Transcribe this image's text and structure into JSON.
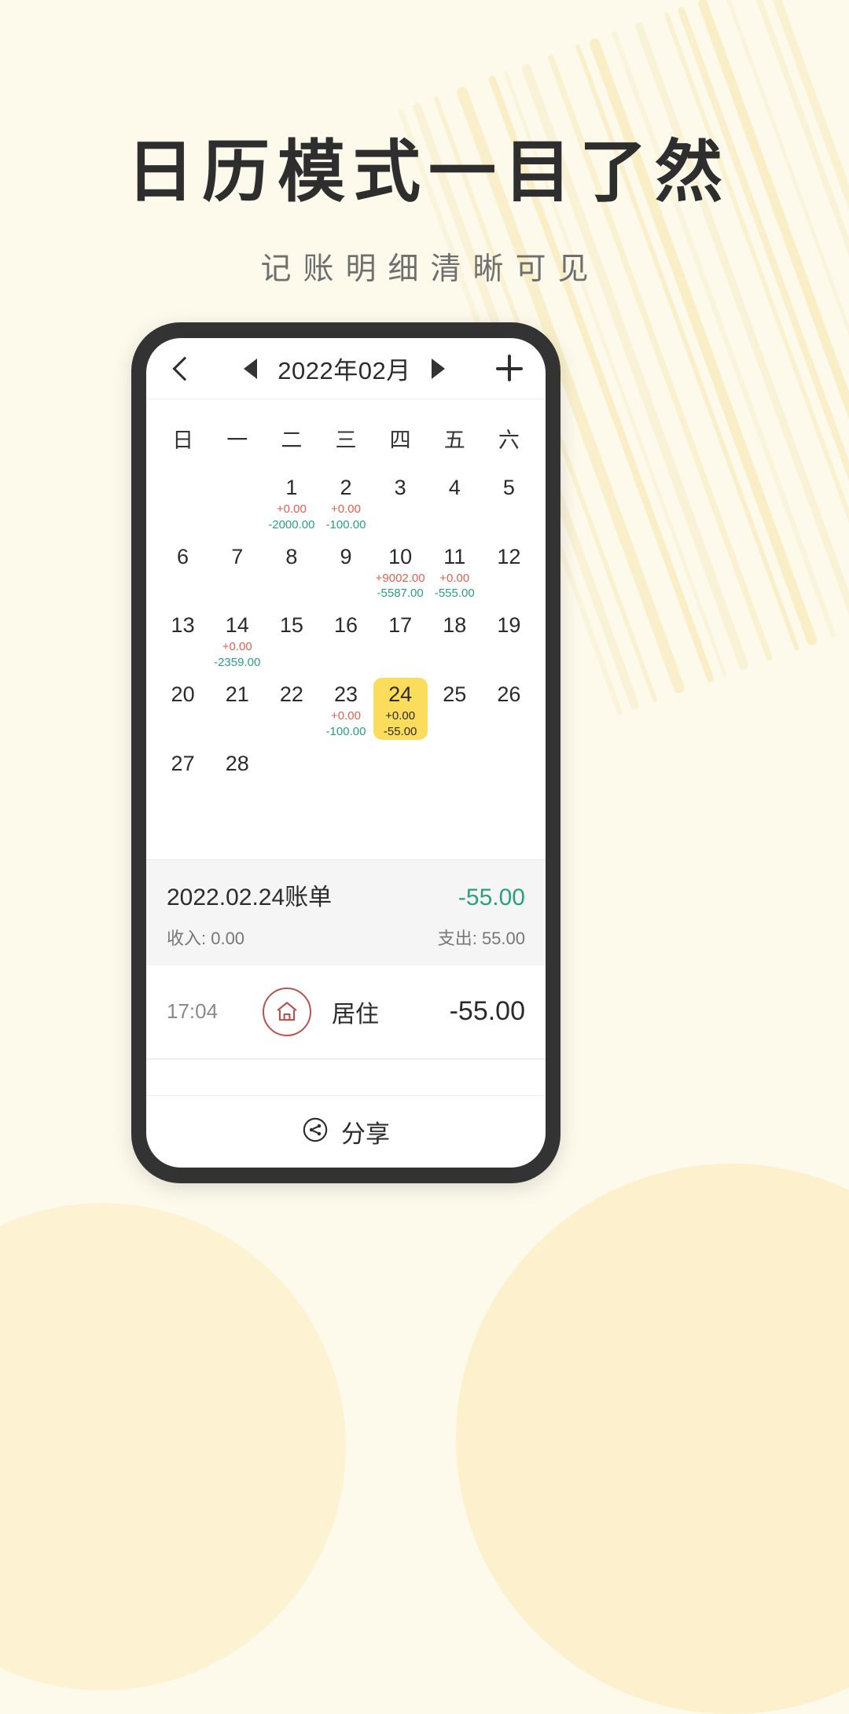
{
  "promo": {
    "headline": "日历模式一目了然",
    "subheadline": "记账明细清晰可见"
  },
  "app": {
    "header": {
      "back_icon": "back-chevron-icon",
      "prev_month_icon": "triangle-left-icon",
      "month_label": "2022年02月",
      "next_month_icon": "triangle-right-icon",
      "add_icon": "plus-icon"
    },
    "calendar": {
      "weekdays": [
        "日",
        "一",
        "二",
        "三",
        "四",
        "五",
        "六"
      ],
      "weeks": [
        [
          {
            "day": ""
          },
          {
            "day": ""
          },
          {
            "day": "1",
            "income": "+0.00",
            "expense": "-2000.00"
          },
          {
            "day": "2",
            "income": "+0.00",
            "expense": "-100.00"
          },
          {
            "day": "3"
          },
          {
            "day": "4"
          },
          {
            "day": "5"
          }
        ],
        [
          {
            "day": "6"
          },
          {
            "day": "7"
          },
          {
            "day": "8"
          },
          {
            "day": "9"
          },
          {
            "day": "10",
            "income": "+9002.00",
            "expense": "-5587.00"
          },
          {
            "day": "11",
            "income": "+0.00",
            "expense": "-555.00"
          },
          {
            "day": "12"
          }
        ],
        [
          {
            "day": "13"
          },
          {
            "day": "14",
            "income": "+0.00",
            "expense": "-2359.00"
          },
          {
            "day": "15"
          },
          {
            "day": "16"
          },
          {
            "day": "17"
          },
          {
            "day": "18"
          },
          {
            "day": "19"
          }
        ],
        [
          {
            "day": "20"
          },
          {
            "day": "21"
          },
          {
            "day": "22"
          },
          {
            "day": "23",
            "income": "+0.00",
            "expense": "-100.00"
          },
          {
            "day": "24",
            "income": "+0.00",
            "expense": "-55.00",
            "selected": true
          },
          {
            "day": "25"
          },
          {
            "day": "26"
          }
        ],
        [
          {
            "day": "27"
          },
          {
            "day": "28"
          },
          {
            "day": ""
          },
          {
            "day": ""
          },
          {
            "day": ""
          },
          {
            "day": ""
          },
          {
            "day": ""
          }
        ]
      ]
    },
    "day_summary": {
      "title": "2022.02.24账单",
      "total": "-55.00",
      "income_label": "收入: 0.00",
      "expense_label": "支出: 55.00"
    },
    "transactions": [
      {
        "time": "17:04",
        "icon": "house-icon",
        "category": "居住",
        "amount": "-55.00"
      }
    ],
    "footer": {
      "share_icon": "share-icon",
      "share_label": "分享"
    }
  },
  "colors": {
    "page_background": "#fdfaec",
    "stripe": "#f7e9b8",
    "phone_bezel": "#333334",
    "selected_day": "#fbdc5b",
    "income_red": "#e1604f",
    "expense_green": "#28a07f",
    "category_icon": "#b8524f"
  }
}
